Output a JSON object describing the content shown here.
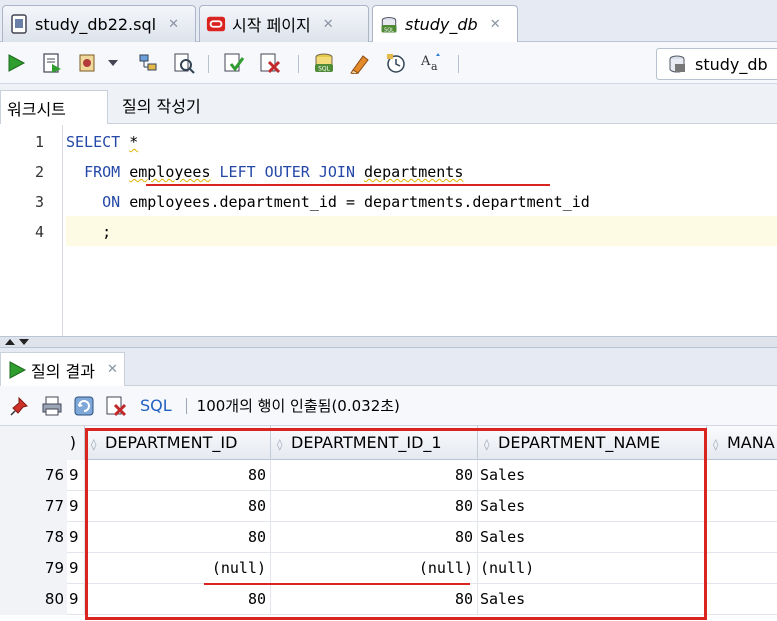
{
  "tabs": [
    {
      "label": "study_db22.sql",
      "icon": "sql-file-icon",
      "active": false
    },
    {
      "label": "시작 페이지",
      "icon": "oracle-icon",
      "active": false
    },
    {
      "label": "study_db",
      "icon": "sql-worksheet-icon",
      "active": true
    }
  ],
  "toolbar": {
    "icons": [
      "run-statement-icon",
      "run-script-icon",
      "autotrace-icon",
      "dropdown-arrow-icon",
      "explain-plan-icon",
      "sql-tuning-icon",
      "commit-icon",
      "rollback-icon",
      "unshared-sql-icon",
      "clear-icon",
      "sql-history-icon",
      "format-case-icon"
    ],
    "connection": "study_db"
  },
  "subtabs": {
    "worksheet": "워크시트",
    "query_builder": "질의 작성기"
  },
  "editor": {
    "lines": [
      {
        "num": "1",
        "tokens": [
          {
            "t": "SELECT",
            "kw": true
          },
          {
            "t": " "
          },
          {
            "t": "*",
            "sq": true
          }
        ]
      },
      {
        "num": "2",
        "tokens": [
          {
            "t": "  "
          },
          {
            "t": "FROM",
            "kw": true
          },
          {
            "t": " "
          },
          {
            "t": "employees",
            "sq": true
          },
          {
            "t": " "
          },
          {
            "t": "LEFT OUTER JOIN",
            "kw": true
          },
          {
            "t": " "
          },
          {
            "t": "departments",
            "sq": true
          }
        ]
      },
      {
        "num": "3",
        "tokens": [
          {
            "t": "    "
          },
          {
            "t": "ON",
            "kw": true
          },
          {
            "t": " employees.department_id = departments.department_id"
          }
        ]
      },
      {
        "num": "4",
        "tokens": [
          {
            "t": "    ;"
          }
        ]
      }
    ]
  },
  "results": {
    "tab_label": "질의 결과",
    "toolbar_icons": [
      "pin-icon",
      "print-icon",
      "refresh-icon",
      "cancel-icon"
    ],
    "sql_label": "SQL",
    "status": "100개의 행이 인출됨(0.032초)",
    "columns": [
      ")",
      "DEPARTMENT_ID",
      "DEPARTMENT_ID_1",
      "DEPARTMENT_NAME",
      "MANA"
    ],
    "rows": [
      {
        "num": "76",
        "partial": "9",
        "dept_id": "80",
        "dept_id_1": "80",
        "dept_name": "Sales"
      },
      {
        "num": "77",
        "partial": "9",
        "dept_id": "80",
        "dept_id_1": "80",
        "dept_name": "Sales"
      },
      {
        "num": "78",
        "partial": "9",
        "dept_id": "80",
        "dept_id_1": "80",
        "dept_name": "Sales"
      },
      {
        "num": "79",
        "partial": "9",
        "dept_id": "(null)",
        "dept_id_1": "(null)",
        "dept_name": "(null)"
      },
      {
        "num": "80",
        "partial": "9",
        "dept_id": "80",
        "dept_id_1": "80",
        "dept_name": "Sales"
      }
    ]
  },
  "colors": {
    "keyword": "#2448a8",
    "annotation": "#d9241f",
    "current_line": "#fdfbe3",
    "sql_link": "#2060c0"
  }
}
